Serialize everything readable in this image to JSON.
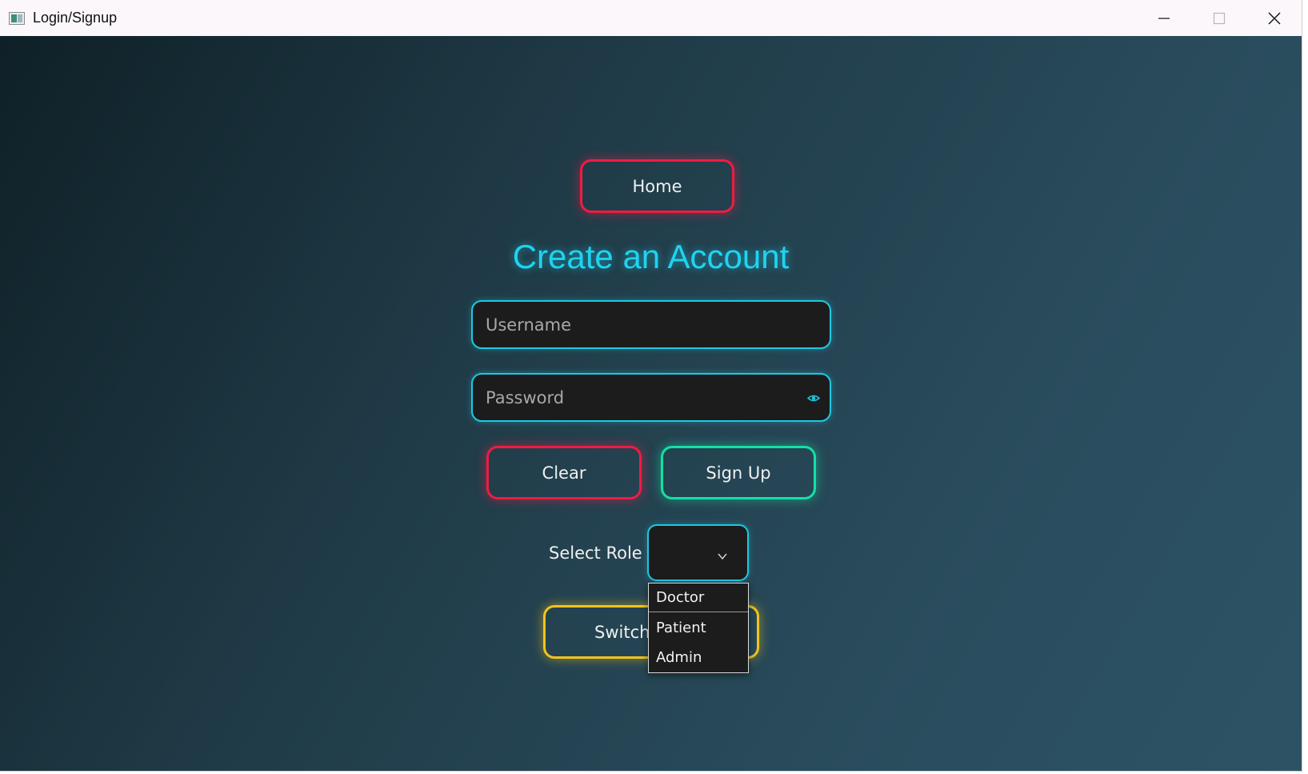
{
  "window": {
    "title": "Login/Signup",
    "controls": [
      "minimize-icon",
      "maximize-icon",
      "close-icon"
    ]
  },
  "form": {
    "home_label": "Home",
    "heading": "Create an Account",
    "username_placeholder": "Username",
    "password_placeholder": "Password",
    "clear_label": "Clear",
    "signup_label": "Sign Up",
    "role_label": "Select Role",
    "switch_label": "Switch",
    "role_options": [
      "Doctor",
      "Patient",
      "Admin"
    ]
  },
  "colors": {
    "accent_cyan": "#1fd3f0",
    "red": "#ee1c44",
    "green": "#14e0a4",
    "yellow": "#f2c31b",
    "field_bg": "#1c1c1d"
  }
}
